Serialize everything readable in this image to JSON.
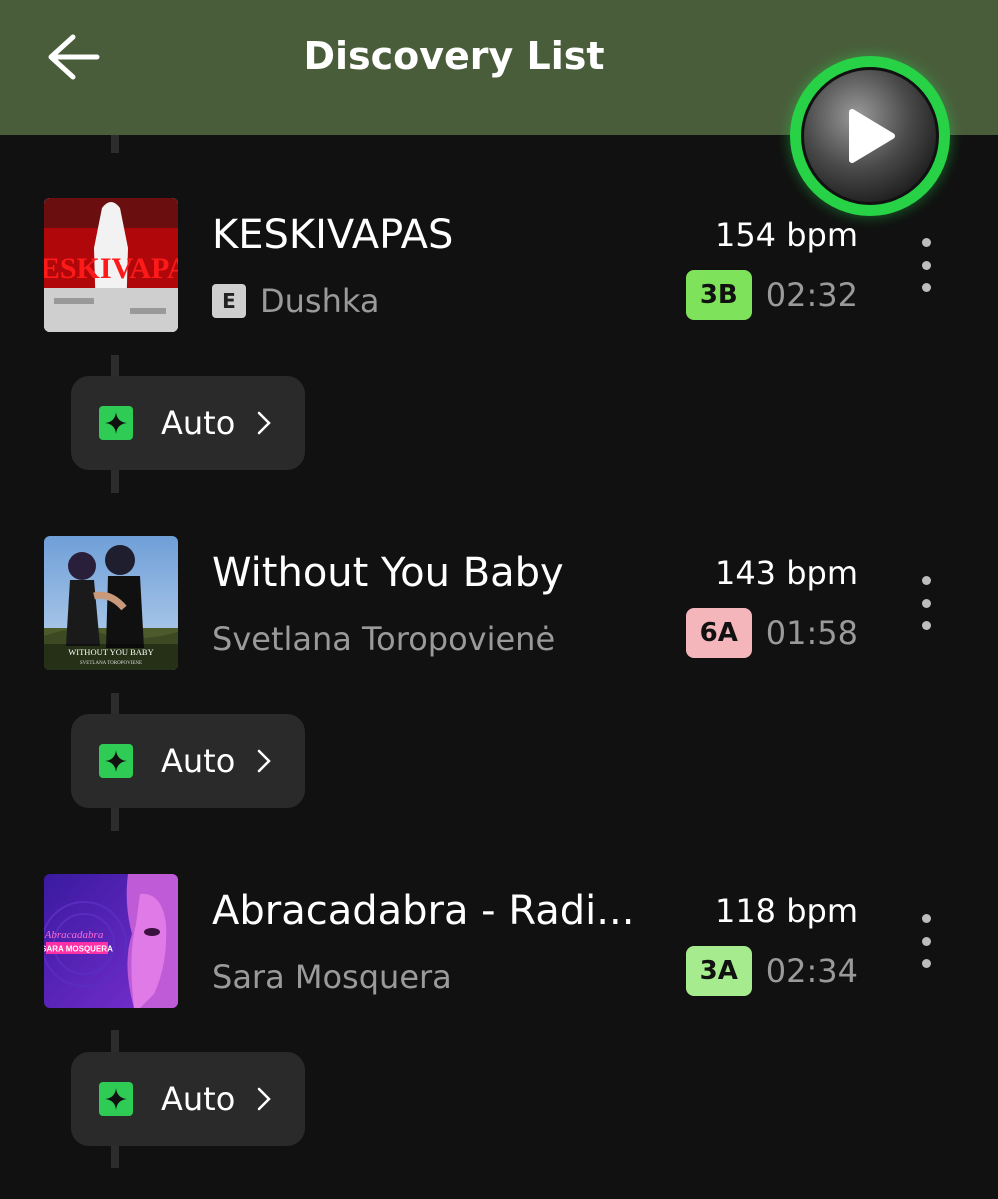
{
  "header": {
    "title": "Discovery List",
    "back_icon": "arrow-left-icon"
  },
  "fab": {
    "icon": "play-icon",
    "accent": "#27d246"
  },
  "tracks": [
    {
      "title": "KESKIVAPAS",
      "explicit": "E",
      "artist": "Dushka",
      "bpm": "154 bpm",
      "key": "3B",
      "key_color": "#7ee35a",
      "duration": "02:32",
      "cover_text": "KESKIVAPAS",
      "auto": {
        "label": "Auto"
      }
    },
    {
      "title": "Without You Baby",
      "artist": "Svetlana Toropovienė",
      "bpm": "143 bpm",
      "key": "6A",
      "key_color": "#f4b6bb",
      "duration": "01:58",
      "cover_text": "WITHOUT YOU BABY",
      "cover_subtext": "SVETLANA TOROPOVIENE",
      "auto": {
        "label": "Auto"
      }
    },
    {
      "title": "Abracadabra - Radi...",
      "artist": "Sara Mosquera",
      "bpm": "118 bpm",
      "key": "3A",
      "key_color": "#a6ec8e",
      "duration": "02:34",
      "cover_text": "Abracadabra",
      "cover_subtext": "SARA MOSQUERA",
      "auto": {
        "label": "Auto"
      }
    }
  ]
}
